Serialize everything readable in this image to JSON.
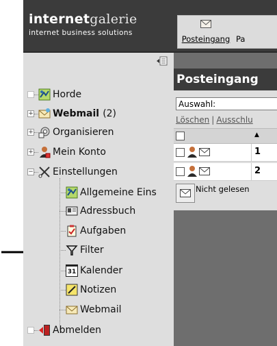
{
  "header": {
    "logo_bold": "internet",
    "logo_light": "galerie",
    "logo_sub": "internet business solutions",
    "inbox_button_label": "Posteingang",
    "next_button_label": "Pa"
  },
  "sidebar": {
    "items": [
      {
        "label": "Horde",
        "icon": "horde-icon"
      },
      {
        "label": "Webmail",
        "count": "(2)",
        "icon": "mail-icon"
      },
      {
        "label": "Organisieren",
        "icon": "organize-icon"
      },
      {
        "label": "Mein Konto",
        "icon": "account-icon"
      },
      {
        "label": "Einstellungen",
        "icon": "settings-icon"
      },
      {
        "label": "Allgemeine Eins",
        "icon": "horde-icon"
      },
      {
        "label": "Adressbuch",
        "icon": "addressbook-icon"
      },
      {
        "label": "Aufgaben",
        "icon": "tasks-icon"
      },
      {
        "label": "Filter",
        "icon": "filter-icon"
      },
      {
        "label": "Kalender",
        "icon": "calendar-icon",
        "icon_text": "31"
      },
      {
        "label": "Notizen",
        "icon": "notes-icon"
      },
      {
        "label": "Webmail",
        "icon": "mail-icon"
      },
      {
        "label": "Abmelden",
        "icon": "logout-icon"
      }
    ]
  },
  "main": {
    "title": "Posteingang",
    "selection_label": "Auswahl:",
    "action_delete": "Löschen",
    "action_separator": "|",
    "action_cut": "Ausschlu",
    "rows": [
      {
        "number": "1"
      },
      {
        "number": "2"
      }
    ],
    "legend_label": "Nicht gelesen"
  },
  "colors": {
    "header_bg": "#3b3b3b",
    "sidebar_bg": "#dedede",
    "main_bg": "#6e6e6e"
  }
}
